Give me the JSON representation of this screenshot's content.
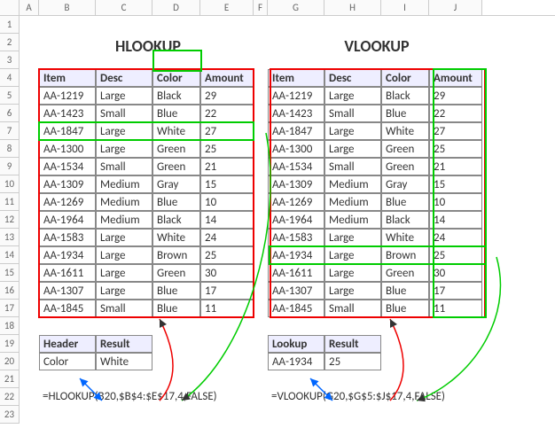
{
  "chart_data": {
    "type": "table",
    "left_title": "HLOOKUP",
    "right_title": "VLOOKUP",
    "headers": [
      "Item",
      "Desc",
      "Color",
      "Amount"
    ],
    "rows": [
      [
        "AA-1219",
        "Large",
        "Black",
        "29"
      ],
      [
        "AA-1423",
        "Small",
        "Blue",
        "22"
      ],
      [
        "AA-1847",
        "Large",
        "White",
        "27"
      ],
      [
        "AA-1300",
        "Large",
        "Green",
        "25"
      ],
      [
        "AA-1534",
        "Small",
        "Green",
        "21"
      ],
      [
        "AA-1309",
        "Medium",
        "Gray",
        "15"
      ],
      [
        "AA-1269",
        "Medium",
        "Blue",
        "10"
      ],
      [
        "AA-1964",
        "Medium",
        "Black",
        "14"
      ],
      [
        "AA-1583",
        "Large",
        "White",
        "24"
      ],
      [
        "AA-1934",
        "Large",
        "Brown",
        "25"
      ],
      [
        "AA-1611",
        "Large",
        "Green",
        "30"
      ],
      [
        "AA-1307",
        "Large",
        "Blue",
        "17"
      ],
      [
        "AA-1845",
        "Small",
        "Blue",
        "11"
      ]
    ],
    "hlookup_box": {
      "headers": [
        "Header",
        "Result"
      ],
      "values": [
        "Color",
        "White"
      ]
    },
    "vlookup_box": {
      "headers": [
        "Lookup",
        "Result"
      ],
      "values": [
        "AA-1934",
        "25"
      ]
    },
    "formula_left": "=HLOOKUP(B20,$B$4:$E$17,4,FALSE)",
    "formula_right": "=VLOOKUP(G20,$G$5:$J$17,4,FALSE)"
  },
  "cols": {
    "labels": [
      "A",
      "B",
      "C",
      "D",
      "E",
      "F",
      "G",
      "H",
      "I",
      "J"
    ],
    "widths": [
      22,
      64,
      64,
      54,
      60,
      16,
      64,
      64,
      54,
      60
    ]
  },
  "rowcount": 23
}
